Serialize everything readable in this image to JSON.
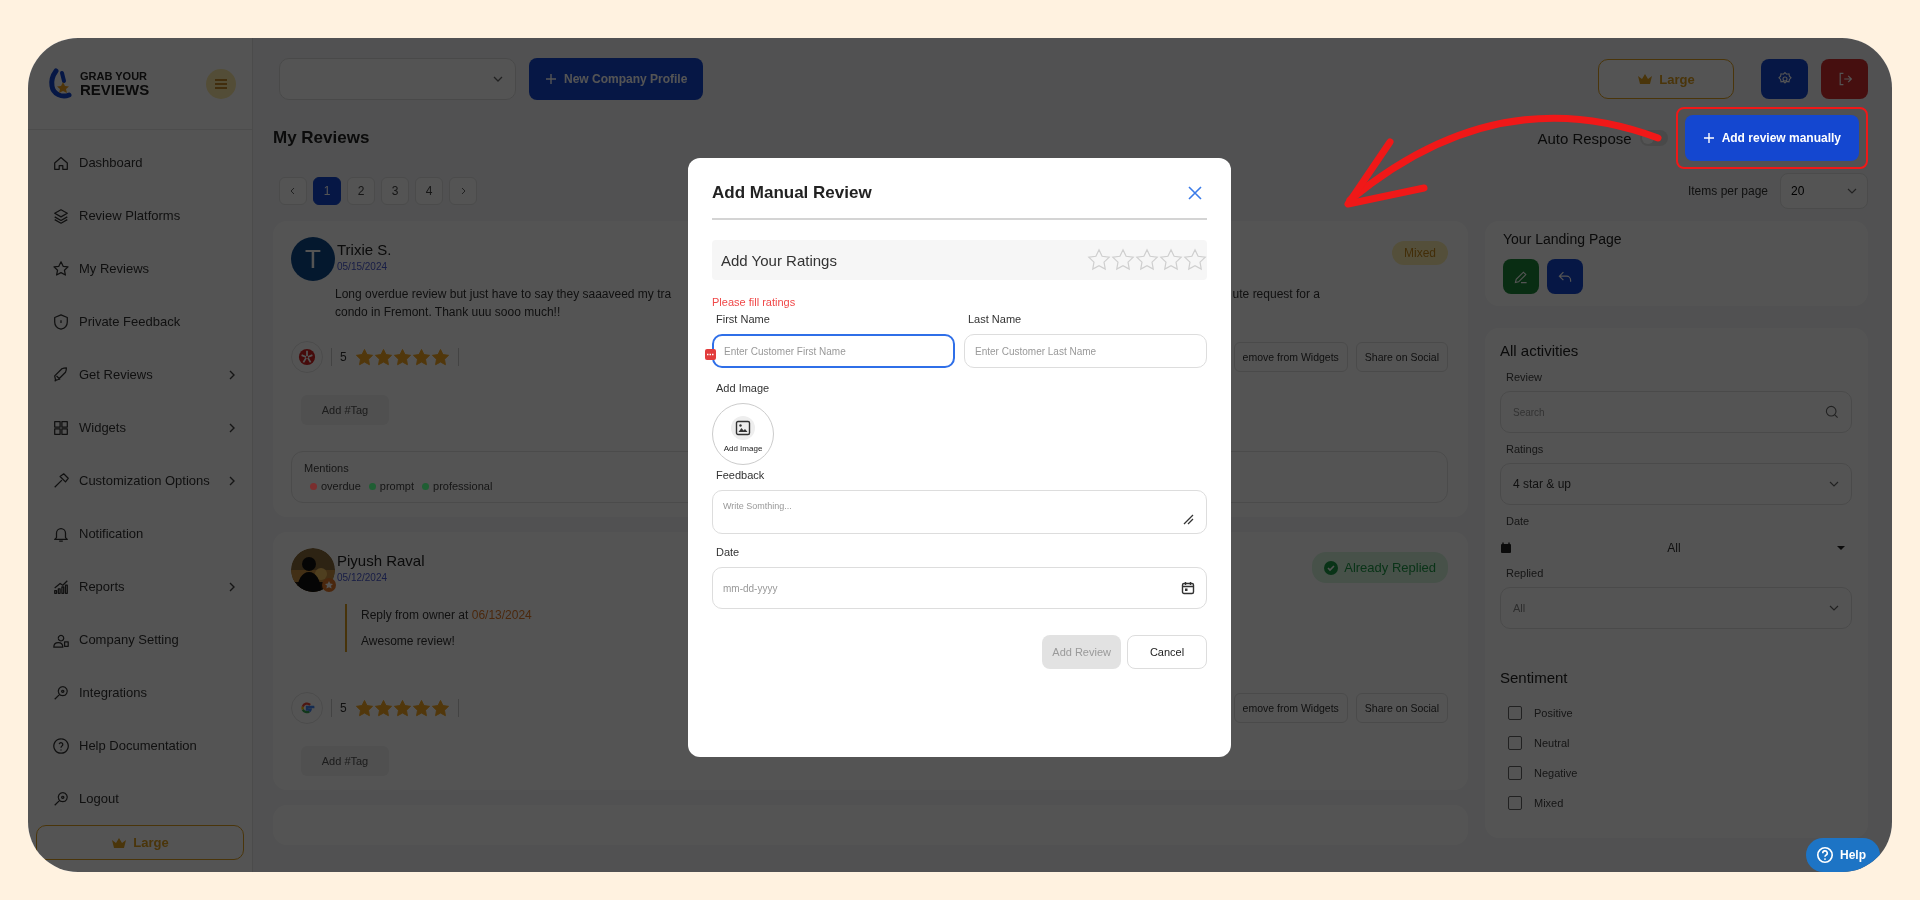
{
  "sidebar": {
    "logo": {
      "line1": "GRAB YOUR",
      "line2": "REVIEWS"
    },
    "items": [
      {
        "label": "Dashboard",
        "submenu": false
      },
      {
        "label": "Review Platforms",
        "submenu": false
      },
      {
        "label": "My Reviews",
        "submenu": false
      },
      {
        "label": "Private Feedback",
        "submenu": false
      },
      {
        "label": "Get Reviews",
        "submenu": true
      },
      {
        "label": "Widgets",
        "submenu": true
      },
      {
        "label": "Customization Options",
        "submenu": true
      },
      {
        "label": "Notification",
        "submenu": false
      },
      {
        "label": "Reports",
        "submenu": true
      },
      {
        "label": "Company Setting",
        "submenu": false
      },
      {
        "label": "Integrations",
        "submenu": false
      },
      {
        "label": "Help Documentation",
        "submenu": false
      },
      {
        "label": "Logout",
        "submenu": false
      }
    ],
    "plan_button": "Large"
  },
  "topbar": {
    "new_profile_button": "New Company Profile",
    "plan_button": "Large"
  },
  "header": {
    "title": "My Reviews",
    "auto_respond": {
      "label": "Auto Respose",
      "on": false
    },
    "add_button": "Add review manually"
  },
  "pagination": {
    "pages": [
      {
        "label": "1",
        "selected": true
      },
      {
        "label": "2",
        "selected": false
      },
      {
        "label": "3",
        "selected": false
      },
      {
        "label": "4",
        "selected": false
      }
    ],
    "items_per_page": {
      "label": "Items per page",
      "value": "20"
    }
  },
  "reviews": [
    {
      "avatar": {
        "kind": "letter",
        "letter": "T"
      },
      "name": "Trixie S.",
      "date": "05/15/2024",
      "badge": {
        "kind": "sentiment",
        "label": "Mixed"
      },
      "text_lines": [
        {
          "left": "Long overdue review but just have to say they saaaveed my tra",
          "right": "ute request for a"
        },
        {
          "left": "condo in Fremont. Thank uuu sooo much!!"
        }
      ],
      "source": {
        "kind": "yelp"
      },
      "rating": "5",
      "stars": 5,
      "tag_button": "Add #Tag",
      "actions": [
        "emove from Widgets",
        "Share on Social"
      ],
      "mentions": {
        "title": "Mentions",
        "items": [
          {
            "label": "overdue",
            "color": "#7a2e2e"
          },
          {
            "label": "prompt",
            "color": "#1f5e33"
          },
          {
            "label": "professional",
            "color": "#1f5e33"
          }
        ]
      }
    },
    {
      "avatar": {
        "kind": "picture"
      },
      "name": "Piyush Raval",
      "date": "05/12/2024",
      "badge": {
        "kind": "replied",
        "label": "Already Replied"
      },
      "reply": {
        "label": "Reply from owner at",
        "date": "06/13/2024",
        "text": "Awesome review!"
      },
      "source": {
        "kind": "google"
      },
      "rating": "5",
      "stars": 5,
      "tag_button": "Add #Tag",
      "actions": [
        "emove from Widgets",
        "Share on Social"
      ]
    }
  ],
  "landing_page": {
    "title": "Your Landing Page"
  },
  "filters": {
    "title": "All activities",
    "review": {
      "label": "Review",
      "placeholder": "Search"
    },
    "ratings": {
      "label": "Ratings",
      "value": "4 star & up"
    },
    "date": {
      "label": "Date",
      "value": "All"
    },
    "replied": {
      "label": "Replied",
      "value": "All"
    },
    "sentiment": {
      "title": "Sentiment",
      "options": [
        {
          "label": "Positive",
          "checked": false
        },
        {
          "label": "Neutral",
          "checked": false
        },
        {
          "label": "Negative",
          "checked": false
        },
        {
          "label": "Mixed",
          "checked": false
        }
      ]
    }
  },
  "modal": {
    "title": "Add Manual Review",
    "ratings": {
      "label": "Add Your Ratings",
      "stars": 0
    },
    "error": "Please fill ratings",
    "first_name": {
      "label": "First Name",
      "placeholder": "Enter Customer First Name",
      "focused": true
    },
    "last_name": {
      "label": "Last Name",
      "placeholder": "Enter Customer Last Name",
      "focused": false
    },
    "image": {
      "label": "Add Image",
      "button": "Add Image"
    },
    "feedback": {
      "label": "Feedback",
      "placeholder": "Write Somthing..."
    },
    "date": {
      "label": "Date",
      "placeholder": "mm-dd-yyyy"
    },
    "submit": {
      "label": "Add Review",
      "disabled": true
    },
    "cancel": "Cancel"
  },
  "help_button": "Help"
}
